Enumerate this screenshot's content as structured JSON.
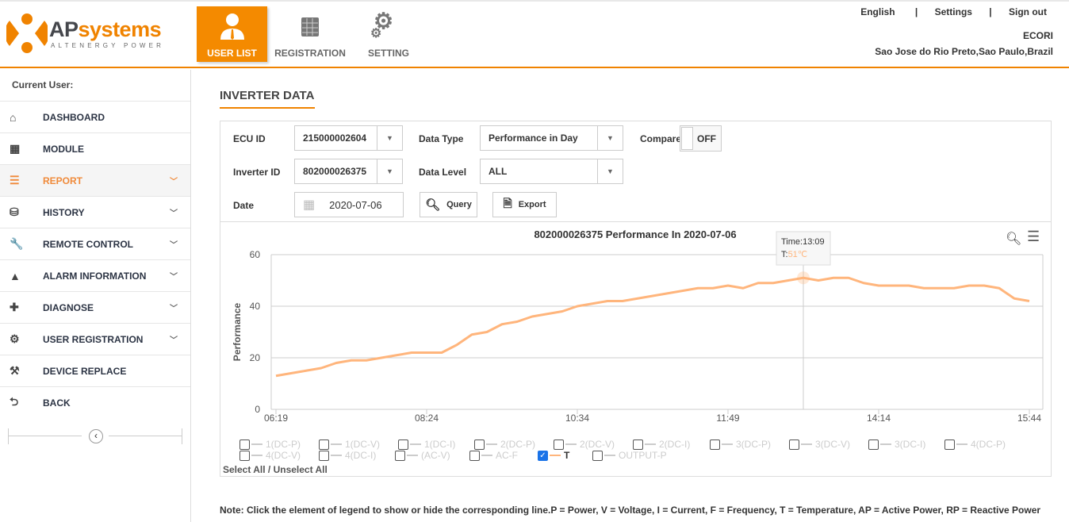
{
  "header": {
    "logo_main": "AP",
    "logo_accent": "systems",
    "logo_sub": "ALTENERGY POWER",
    "nav": [
      {
        "label": "USER LIST",
        "icon": "user-icon",
        "active": true
      },
      {
        "label": "REGISTRATION",
        "icon": "solar-panel-icon"
      },
      {
        "label": "SETTING",
        "icon": "gears-icon"
      }
    ],
    "links": {
      "language": "English",
      "settings": "Settings",
      "signout": "Sign out",
      "sep": "|"
    },
    "user": "ECORI",
    "location": "Sao Jose do Rio Preto,Sao Paulo,Brazil"
  },
  "sidebar": {
    "current_user": "Current User:",
    "items": [
      {
        "label": "DASHBOARD",
        "icon": "home-icon",
        "glyph": "⌂"
      },
      {
        "label": "MODULE",
        "icon": "grid-icon",
        "glyph": "▦"
      },
      {
        "label": "REPORT",
        "icon": "report-icon",
        "glyph": "☰",
        "active": true,
        "chevron": true
      },
      {
        "label": "HISTORY",
        "icon": "database-icon",
        "glyph": "⛁",
        "chevron": true
      },
      {
        "label": "REMOTE CONTROL",
        "icon": "wrench-icon",
        "glyph": "🔧",
        "chevron": true
      },
      {
        "label": "ALARM INFORMATION",
        "icon": "warning-icon",
        "glyph": "▲",
        "chevron": true
      },
      {
        "label": "DIAGNOSE",
        "icon": "medkit-icon",
        "glyph": "✚",
        "chevron": true
      },
      {
        "label": "USER REGISTRATION",
        "icon": "gears-icon",
        "glyph": "⚙",
        "chevron": true
      },
      {
        "label": "DEVICE REPLACE",
        "icon": "tools-icon",
        "glyph": "⚒"
      },
      {
        "label": "BACK",
        "icon": "back-icon",
        "glyph": "⮌"
      }
    ],
    "collapse_glyph": "‹"
  },
  "main": {
    "title": "INVERTER DATA",
    "filters": {
      "ecu_label": "ECU ID",
      "ecu_value": "215000002604",
      "inverter_label": "Inverter ID",
      "inverter_value": "802000026375",
      "date_label": "Date",
      "date_value": "2020-07-06",
      "type_label": "Data Type",
      "type_value": "Performance in Day",
      "level_label": "Data Level",
      "level_value": "ALL",
      "compare_label": "Compare",
      "compare_value": "OFF",
      "query": "Query",
      "export": "Export"
    },
    "legend": [
      {
        "label": "1(DC-P)"
      },
      {
        "label": "1(DC-V)"
      },
      {
        "label": "1(DC-I)"
      },
      {
        "label": "2(DC-P)"
      },
      {
        "label": "2(DC-V)"
      },
      {
        "label": "2(DC-I)"
      },
      {
        "label": "3(DC-P)"
      },
      {
        "label": "3(DC-V)"
      },
      {
        "label": "3(DC-I)"
      },
      {
        "label": "4(DC-P)"
      },
      {
        "label": "4(DC-V)"
      },
      {
        "label": "4(DC-I)"
      },
      {
        "label": "(AC-V)"
      },
      {
        "label": "AC-F"
      },
      {
        "label": "T",
        "checked": true
      },
      {
        "label": "OUTPUT-P"
      }
    ],
    "select_all": "Select All / Unselect All",
    "note": "Note: Click the element of legend to show or hide the corresponding line.P = Power, V = Voltage, I = Current, F = Frequency, T = Temperature, AP = Active Power, RP = Reactive Power"
  },
  "chart_data": {
    "type": "line",
    "title": "802000026375 Performance In 2020-07-06",
    "ylabel": "Performance",
    "xlabel": "",
    "ylim": [
      0,
      60
    ],
    "yticks": [
      0,
      20,
      40,
      60
    ],
    "grid": true,
    "xtick_labels": [
      "06:19",
      "08:24",
      "10:34",
      "11:49",
      "14:14",
      "15:44"
    ],
    "series": [
      {
        "name": "T",
        "color": "#ffb57c",
        "values": [
          13,
          14,
          15,
          16,
          18,
          19,
          19,
          20,
          21,
          22,
          22,
          22,
          25,
          29,
          30,
          33,
          34,
          36,
          37,
          38,
          40,
          41,
          42,
          42,
          43,
          44,
          45,
          46,
          47,
          47,
          48,
          47,
          49,
          49,
          50,
          51,
          50,
          51,
          51,
          49,
          48,
          48,
          48,
          47,
          47,
          47,
          48,
          48,
          47,
          43,
          42
        ]
      }
    ],
    "tooltip": {
      "time": "Time:13:09",
      "value_prefix": "T:",
      "value": "51℃",
      "index": 35
    }
  }
}
